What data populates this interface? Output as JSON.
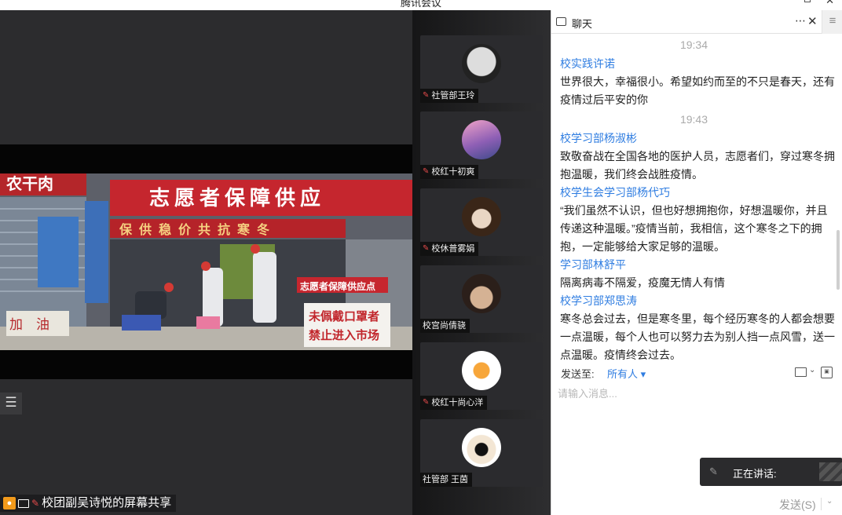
{
  "window": {
    "title": "腾讯会议"
  },
  "main": {
    "list_icon": "list-icon",
    "share_caption": "校团副吴诗悦的屏幕共享",
    "photo_signs": {
      "top_left": "农干肉",
      "banner": "志愿者保障供应",
      "sub_banner": "保供稳价共抗寒冬",
      "panel_small": "志愿者保障供应点",
      "panel_big_1": "未佩戴口罩者",
      "panel_big_2": "禁止进入市场",
      "bottom_left": "加　油"
    }
  },
  "participants": [
    {
      "name": "社管部王玲",
      "muted": true
    },
    {
      "name": "校红十初爽",
      "muted": true
    },
    {
      "name": "校休普雾娟",
      "muted": true
    },
    {
      "name": "校宫尚倩骁",
      "muted": false
    },
    {
      "name": "校红十尚心洋",
      "muted": true
    },
    {
      "name": "社管部 王茵",
      "muted": false
    }
  ],
  "chat": {
    "title": "聊天",
    "more_icon": "more-icon",
    "close_icon": "close-icon",
    "menu_icon": "menu-icon",
    "messages": [
      {
        "time": "19:34"
      },
      {
        "sender": "校实践许诺",
        "lines": [
          "世界很大，幸福很小。希望如约而至的不只是春天，还有",
          "疫情过后平安的你"
        ]
      },
      {
        "time": "19:43"
      },
      {
        "sender": "校学习部杨淑彬",
        "lines": [
          "致敬奋战在全国各地的医护人员，志愿者们，穿过寒冬拥",
          "抱温暖，我们终会战胜疫情。"
        ]
      },
      {
        "sender": "校学生会学习部杨代巧",
        "lines": [
          "“我们虽然不认识，但也好想拥抱你，好想温暖你，并且",
          "传递这种温暖。”疫情当前，我相信，这个寒冬之下的拥",
          "抱，一定能够给大家足够的温暖。"
        ]
      },
      {
        "sender": "学习部林舒平",
        "lines": [
          "隔离病毒不隔爱，疫魔无情人有情"
        ]
      },
      {
        "sender": "校学习部郑思涛",
        "lines": [
          "寒冬总会过去，但是寒冬里，每个经历寒冬的人都会想要",
          "一点温暖，每个人也可以努力去为别人挡一点风雪，送一",
          "点温暖。疫情终会过去。"
        ]
      }
    ],
    "send_to_label": "发送至:",
    "send_to_value": "所有人 ▾",
    "input_placeholder": "请输入消息...",
    "speaking_label": "正在讲话:",
    "send_button": "发送(S)"
  }
}
